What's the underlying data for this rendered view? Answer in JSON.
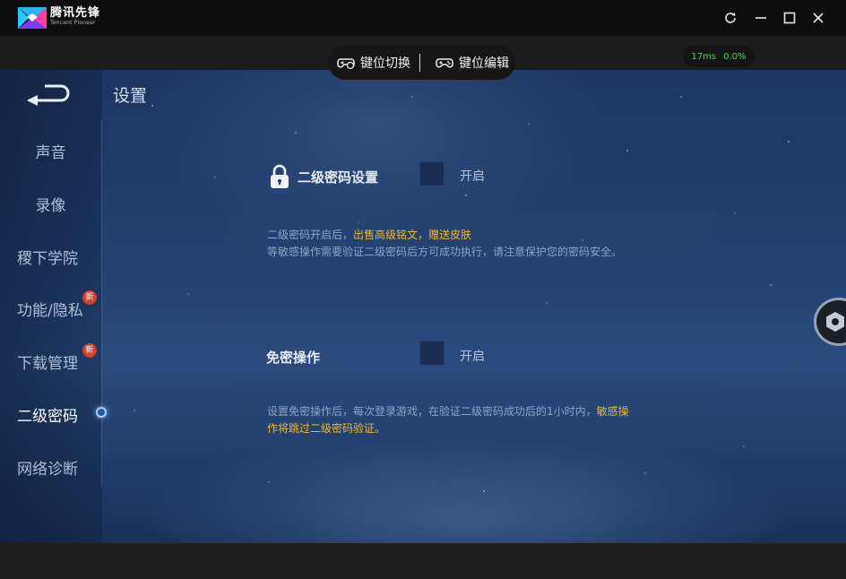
{
  "app": {
    "name": "腾讯先锋",
    "name_en": "Tencent Pioneer",
    "accent": "#2ec8ff"
  },
  "window_controls": {
    "refresh": "refresh-icon",
    "minimize": "minimize-icon",
    "maximize": "maximize-icon",
    "close": "close-icon"
  },
  "keybar": {
    "switch_label": "键位切换",
    "edit_label": "键位编辑"
  },
  "network": {
    "latency": "17ms",
    "loss": "0.0%",
    "color": "#3fdc4d"
  },
  "settings": {
    "title": "设置",
    "nav": [
      {
        "label": "声音",
        "badge": ""
      },
      {
        "label": "录像",
        "badge": ""
      },
      {
        "label": "稷下学院",
        "badge": ""
      },
      {
        "label": "功能/隐私",
        "badge": "新"
      },
      {
        "label": "下载管理",
        "badge": "新"
      },
      {
        "label": "二级密码",
        "badge": "",
        "active": true
      },
      {
        "label": "网络诊断",
        "badge": ""
      }
    ],
    "secondary_password": {
      "label": "二级密码设置",
      "toggle": "开启",
      "desc_line1_prefix": "二级密码开启后，",
      "desc_line1_highlight": "出售高级铭文，赠送皮肤",
      "desc_line2": "等敏感操作需要验证二级密码后方可成功执行，请注意保护您的密码安全。"
    },
    "password_free": {
      "label": "免密操作",
      "toggle": "开启",
      "desc_line1_prefix": "设置免密操作后，每次登录游戏，在验证二级密码成功后的1小时内，",
      "desc_line1_highlight": "敏感操",
      "desc_line2_highlight": "作将跳过二级密码验证。"
    }
  },
  "colors": {
    "highlight": "#e8b932",
    "badge": "#d3412f"
  }
}
